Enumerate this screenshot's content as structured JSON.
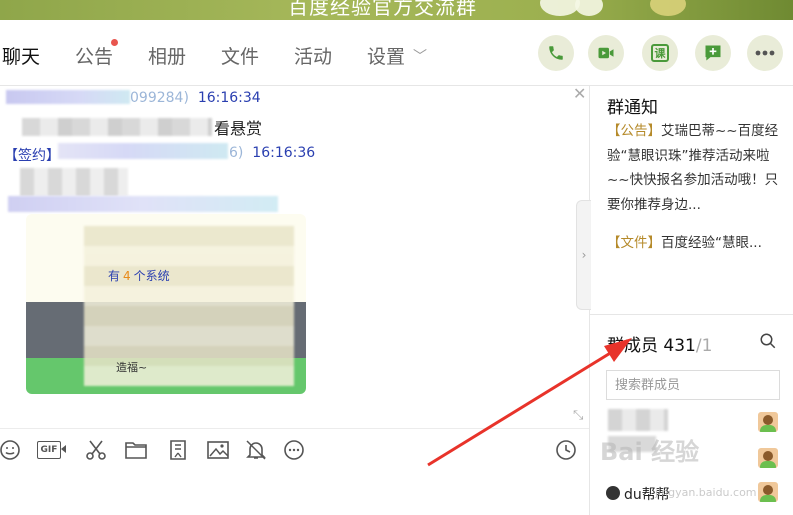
{
  "banner": {
    "title": "百度经验官方交流群"
  },
  "nav": {
    "tabs": [
      {
        "label": "聊天",
        "active": true
      },
      {
        "label": "公告",
        "badge": true
      },
      {
        "label": "相册"
      },
      {
        "label": "文件"
      },
      {
        "label": "活动"
      },
      {
        "label": "设置"
      }
    ],
    "actions": [
      "phone-icon",
      "video-icon",
      "course-icon",
      "add-app-icon",
      "more-icon"
    ],
    "action_labels": {
      "course": "课"
    }
  },
  "chat": {
    "messages": [
      {
        "id_suffix": "099284)",
        "time": "16:16:34",
        "text": "看悬赏"
      },
      {
        "tag": "【签约】",
        "id_suffix": "6)",
        "time": "16:16:36"
      }
    ],
    "card": {
      "line1_prefix": "有",
      "line1_count": "4",
      "line1_suffix": "个系统",
      "line2": "造福~"
    }
  },
  "toolbar": {
    "gif_label": "GIF",
    "icons": [
      "emoji-icon",
      "gif-icon",
      "scissors-icon",
      "folder-icon",
      "screenshot-icon",
      "image-icon",
      "bell-off-icon",
      "more-circle-icon",
      "history-clock-icon"
    ]
  },
  "notice_panel": {
    "title": "群通知",
    "item1_tag": "【公告】",
    "item1_text": "艾瑞巴蒂~~百度经验“慧眼识珠”推荐活动来啦~~快快报名参加活动哦！只要你推荐身边...",
    "item2_tag": "【文件】",
    "item2_text": "百度经验“慧眼..."
  },
  "members_panel": {
    "title": "群成员",
    "count": "431",
    "count_total": "/1",
    "search_placeholder": "搜索群成员",
    "members": [
      {
        "name": ""
      },
      {
        "name": ""
      },
      {
        "name": "du帮帮"
      }
    ]
  },
  "watermark": {
    "text": "Bai 经验",
    "sub": "jingyan.baidu.com"
  },
  "colors": {
    "accent_green": "#4a9a3a",
    "link_blue": "#2a3fb0",
    "badge_red": "#e8554e",
    "arrow_red": "#e8332a"
  }
}
